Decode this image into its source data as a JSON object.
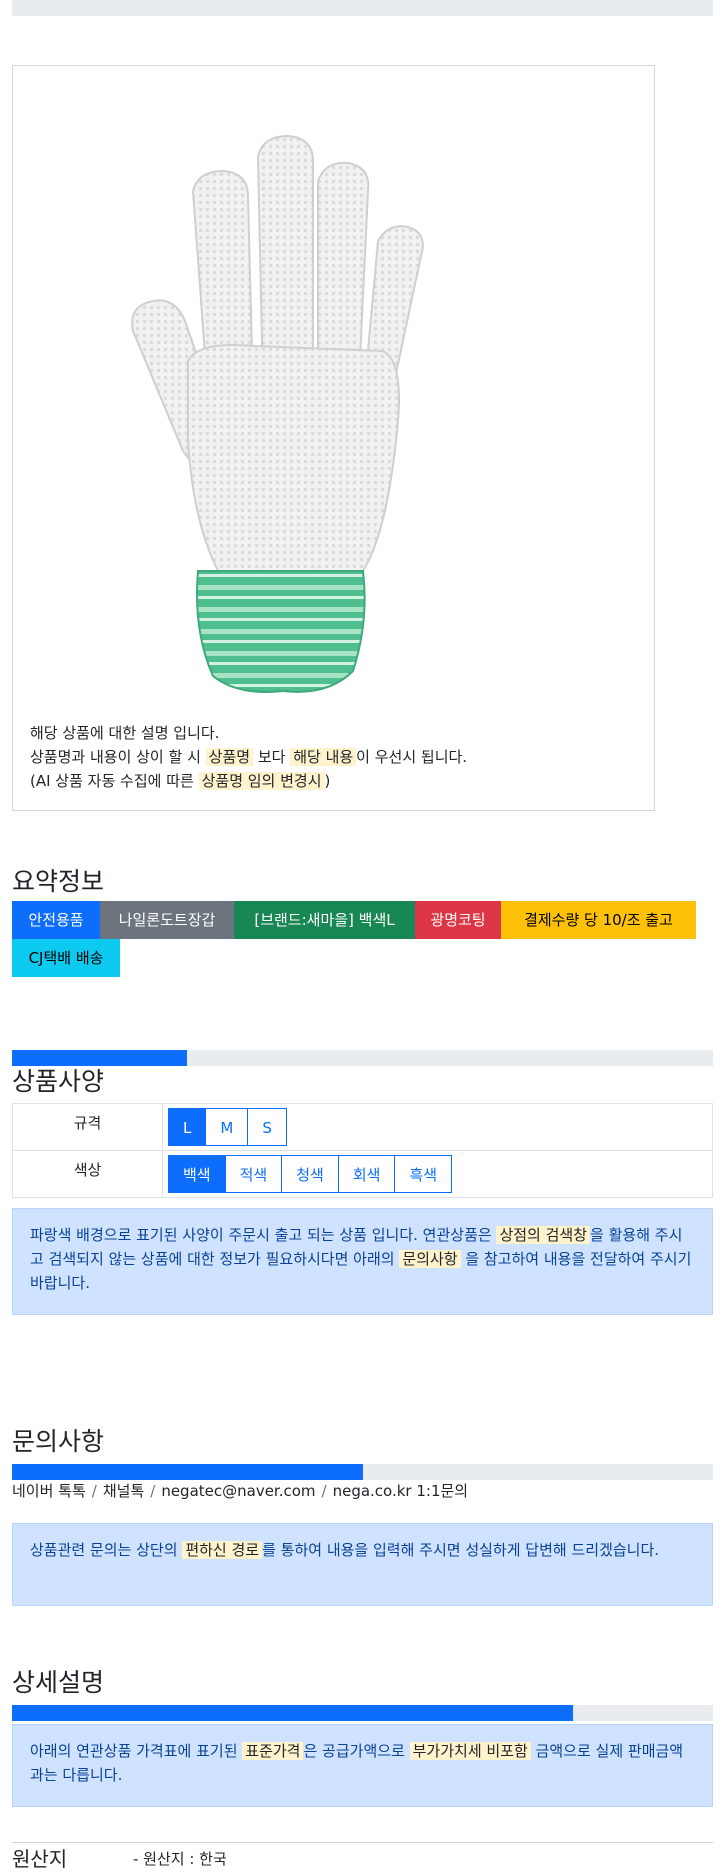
{
  "description": {
    "line1": "해당 상품에 대한 설명 입니다.",
    "line2_pre": "상품명과 내용이 상이 할 시 ",
    "line2_mark1": "상품명",
    "line2_mid": " 보다 ",
    "line2_mark2": "해당 내용",
    "line2_post": "이 우선시 됩니다.",
    "line3_pre": "(AI 상품 자동 수집에 따른 ",
    "line3_mark": "상품명 임의 변경시",
    "line3_post": ")"
  },
  "summary": {
    "title": "요약정보",
    "tags": [
      {
        "label": "안전용품",
        "color": "#0d6efd",
        "text": "#ffffff"
      },
      {
        "label": "나일론도트장갑",
        "color": "#6c757d",
        "text": "#ffffff"
      },
      {
        "label": "[브랜드:새마을] 백색L",
        "color": "#198754",
        "text": "#ffffff"
      },
      {
        "label": "광명코팅",
        "color": "#dc3545",
        "text": "#ffffff"
      },
      {
        "label": "결제수량 당 10/조 출고",
        "color": "#ffc107",
        "text": "#000000"
      },
      {
        "label": "CJ택배 배송",
        "color": "#0dcaf0",
        "text": "#000000"
      }
    ]
  },
  "spec": {
    "progress_percent": 25,
    "title": "상품사양",
    "rows": [
      {
        "label": "규격",
        "options": [
          "L",
          "M",
          "S"
        ],
        "selected": "L"
      },
      {
        "label": "색상",
        "options": [
          "백색",
          "적색",
          "청색",
          "회색",
          "흑색"
        ],
        "selected": "백색"
      }
    ],
    "notice_pre": "파랑색 배경으로 표기된 사양이 주문시 출고 되는 상품 입니다. 연관상품은 ",
    "notice_mark1": "상점의 검색창",
    "notice_mid": "을 활용해 주시고 검색되지 않는 상품에 대한 정보가 필요하시다면 아래의 ",
    "notice_mark2": "문의사항",
    "notice_post": " 을 참고하여 내용을 전달하여 주시기 바랍니다."
  },
  "inquiry": {
    "title": "문의사항",
    "progress_percent": 50,
    "contacts": [
      "네이버 톡톡",
      "채널톡",
      "negatec@naver.com",
      "nega.co.kr 1:1문의"
    ],
    "separator": "/",
    "notice_pre": "상품관련 문의는 상단의 ",
    "notice_mark": "편하신 경로",
    "notice_post": "를 통하여 내용을 입력해 주시면 성실하게 답변해 드리겠습니다."
  },
  "detail": {
    "title": "상세설명",
    "progress_percent": 80,
    "notice_pre": "아래의 연관상품 가격표에 표기된 ",
    "notice_mark1": "표준가격",
    "notice_mid": "은 공급가액으로 ",
    "notice_mark2": "부가가치세 비포함",
    "notice_post": " 금액으로 실제 판매금액과는 다릅니다."
  },
  "origin": {
    "label": "원산지",
    "value": "- 원산지 : 한국"
  },
  "icons": {
    "product_image": "white-nylon-dot-glove-image"
  }
}
